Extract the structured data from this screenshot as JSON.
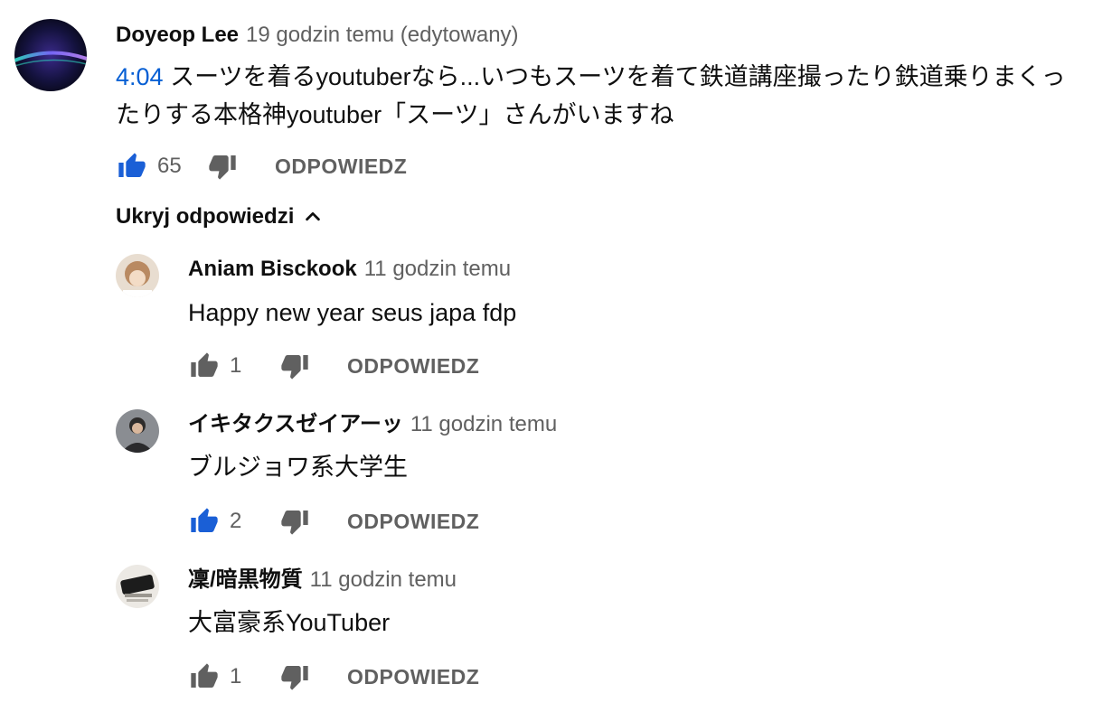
{
  "top_comment": {
    "author": "Doyeop Lee",
    "time": "19 godzin temu (edytowany)",
    "timestamp": "4:04",
    "text_line1": "スーツを着るyoutuberなら...いつもスーツを着て鉄道講座撮ったり鉄道乗りまくっ",
    "text_line2": "たりする本格神youtuber「スーツ」さんがいますね",
    "likes": "65",
    "liked": true,
    "reply_label": "ODPOWIEDZ"
  },
  "hide_replies_label": "Ukryj odpowiedzi",
  "replies": [
    {
      "author": "Aniam Bisckook",
      "time": "11 godzin temu",
      "text": "Happy new year seus japa fdp",
      "likes": "1",
      "liked": false,
      "reply_label": "ODPOWIEDZ"
    },
    {
      "author": "イキタクスゼイアーッ",
      "time": "11 godzin temu",
      "text": "ブルジョワ系大学生",
      "likes": "2",
      "liked": true,
      "reply_label": "ODPOWIEDZ"
    },
    {
      "author": "凜/暗黒物質",
      "time": "11 godzin temu",
      "text": "大富豪系YouTuber",
      "likes": "1",
      "liked": false,
      "reply_label": "ODPOWIEDZ"
    }
  ],
  "colors": {
    "link_blue": "#065fd4",
    "like_active": "#1a5fd6",
    "icon_gray": "#606060",
    "text_primary": "#0f0f0f",
    "text_secondary": "#606060"
  },
  "icons": [
    "thumb-up-icon",
    "thumb-down-icon",
    "chevron-up-icon"
  ]
}
